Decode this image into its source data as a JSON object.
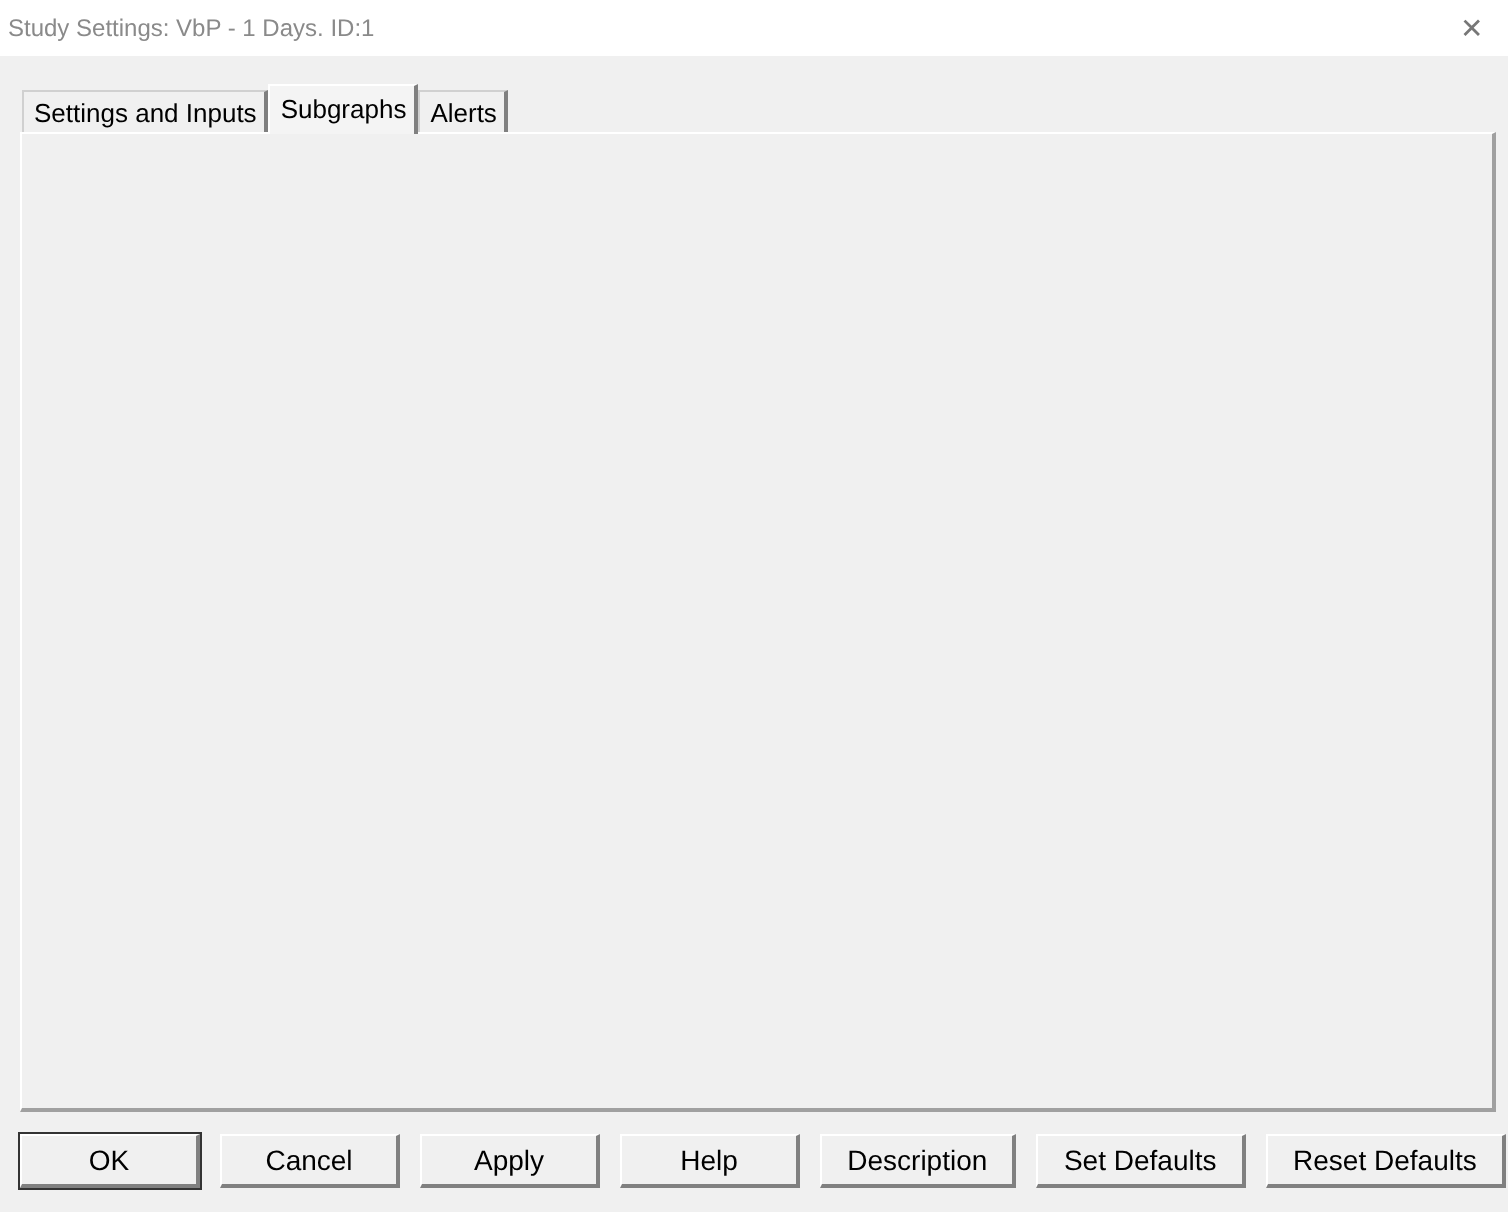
{
  "window": {
    "title": "Study Settings: VbP - 1 Days. ID:1",
    "close": "✕"
  },
  "tabs": [
    {
      "label": "Settings and Inputs",
      "selected": false
    },
    {
      "label": "Subgraphs",
      "selected": true
    },
    {
      "label": "Alerts",
      "selected": false
    }
  ],
  "buttons": [
    {
      "label": "OK",
      "default": true
    },
    {
      "label": "Cancel",
      "default": false
    },
    {
      "label": "Apply",
      "default": false
    },
    {
      "label": "Help",
      "default": false
    },
    {
      "label": "Description",
      "default": false
    },
    {
      "label": "Set Defaults",
      "default": false
    },
    {
      "label": "Reset Defaults",
      "default": false
    }
  ]
}
